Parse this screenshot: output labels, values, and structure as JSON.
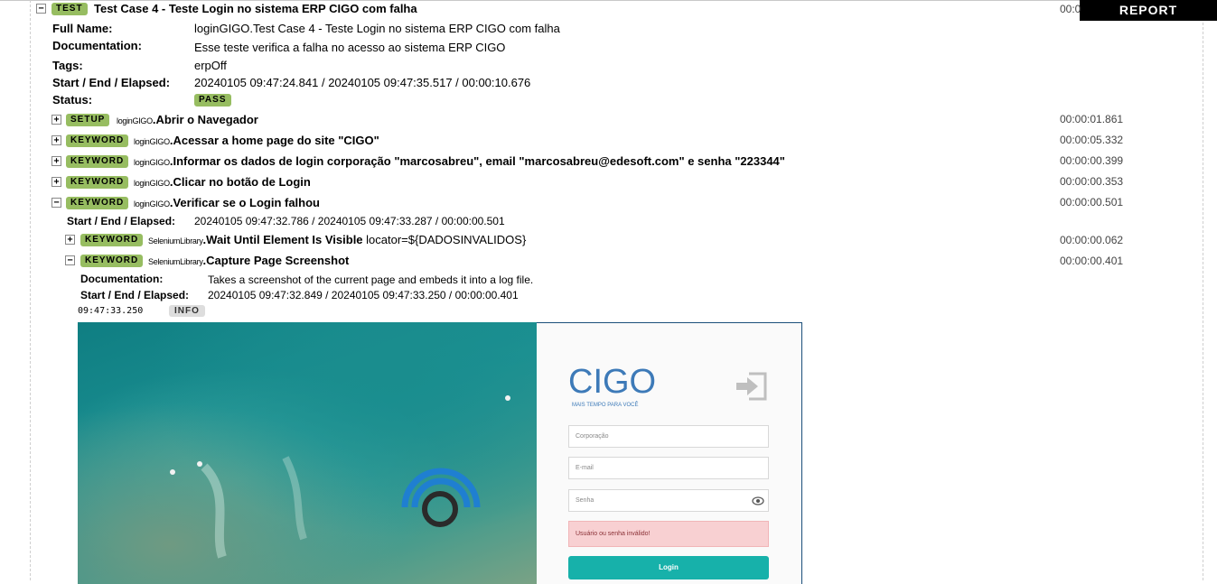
{
  "report_button": "REPORT",
  "test": {
    "badge": "TEST",
    "title": "Test Case 4 - Teste Login no sistema ERP CIGO com falha",
    "elapsed_partial": "00:0",
    "full_name_label": "Full Name:",
    "full_name": "loginGIGO.Test Case 4 - Teste Login no sistema ERP CIGO com falha",
    "documentation_label": "Documentation:",
    "documentation": "Esse teste verifica a falha no acesso ao sistema ERP CIGO",
    "tags_label": "Tags:",
    "tags": "erpOff",
    "times_label": "Start / End / Elapsed:",
    "times": "20240105 09:47:24.841 / 20240105 09:47:35.517 / 00:00:10.676",
    "status_label": "Status:",
    "status": "PASS"
  },
  "keywords": [
    {
      "toggle": "+",
      "badge": "SETUP",
      "lib": "loginGIGO",
      "name": "Abrir o Navegador",
      "elapsed": "00:00:01.861"
    },
    {
      "toggle": "+",
      "badge": "KEYWORD",
      "lib": "loginGIGO",
      "name": "Acessar a home page do site \"CIGO\"",
      "elapsed": "00:00:05.332"
    },
    {
      "toggle": "+",
      "badge": "KEYWORD",
      "lib": "loginGIGO",
      "name": "Informar os dados de login corporação \"marcosabreu\", email \"marcosabreu@edesoft.com\" e senha \"223344\"",
      "elapsed": "00:00:00.399"
    },
    {
      "toggle": "+",
      "badge": "KEYWORD",
      "lib": "loginGIGO",
      "name": "Clicar no botão de Login",
      "elapsed": "00:00:00.353"
    },
    {
      "toggle": "−",
      "badge": "KEYWORD",
      "lib": "loginGIGO",
      "name": "Verificar se o Login falhou",
      "elapsed": "00:00:00.501"
    }
  ],
  "verify": {
    "times_label": "Start / End / Elapsed:",
    "times": "20240105 09:47:32.786 / 20240105 09:47:33.287 / 00:00:00.501"
  },
  "subkeywords": [
    {
      "toggle": "+",
      "badge": "KEYWORD",
      "lib": "SeleniumLibrary",
      "name": "Wait Until Element Is Visible",
      "args": "locator=${DADOSINVALIDOS}",
      "elapsed": "00:00:00.062"
    },
    {
      "toggle": "−",
      "badge": "KEYWORD",
      "lib": "SeleniumLibrary",
      "name": "Capture Page Screenshot",
      "args": "",
      "elapsed": "00:00:00.401"
    }
  ],
  "capture": {
    "documentation_label": "Documentation:",
    "documentation": "Takes a screenshot of the current page and embeds it into a log file.",
    "times_label": "Start / End / Elapsed:",
    "times": "20240105 09:47:32.849 / 20240105 09:47:33.250 / 00:00:00.401",
    "log_time": "09:47:33.250",
    "log_level": "INFO"
  },
  "screenshot": {
    "logo_text": "CIGO",
    "logo_tagline": "MAIS TEMPO PARA VOCÊ",
    "corporacao_placeholder": "Corporação",
    "email_placeholder": "E-mail",
    "senha_placeholder": "Senha",
    "error_message": "Usuário ou senha inválido!",
    "login_button": "Login",
    "brand_color": "#3d7ab8",
    "button_color": "#17b1aa"
  }
}
